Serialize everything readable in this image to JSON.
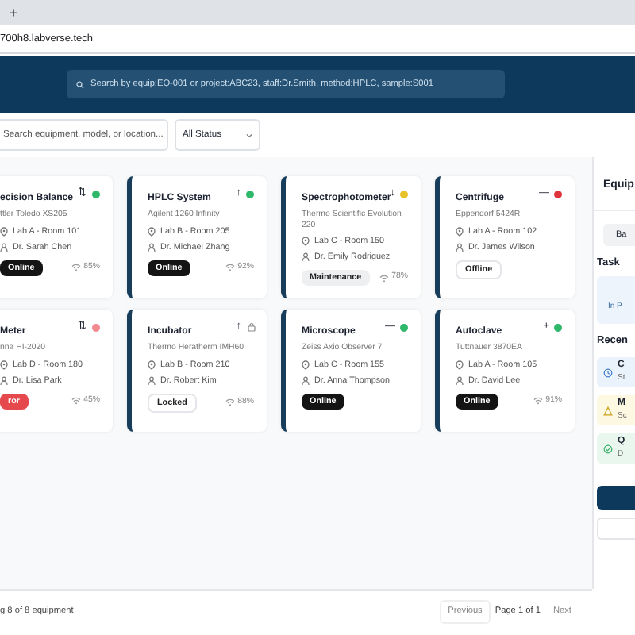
{
  "browser": {
    "new_tab": "+",
    "url": "700h8.labverse.tech"
  },
  "header": {
    "search_placeholder": "Search by equip:EQ-001 or project:ABC23, staff:Dr.Smith, method:HPLC, sample:S001"
  },
  "filters": {
    "search_placeholder": "Search equipment, model, or location...",
    "status_select": "All Status"
  },
  "cards": [
    {
      "title": "ecision Balance",
      "model": "ttler Toledo XS205",
      "location": "Lab A - Room 101",
      "staff": "Dr. Sarah Chen",
      "status": "Online",
      "kind": "online",
      "usage": "85%",
      "trend": "⇅",
      "locked": false,
      "color": "#2fb86a",
      "accent": false
    },
    {
      "title": "HPLC System",
      "model": "Agilent 1260 Infinity",
      "location": "Lab B - Room 205",
      "staff": "Dr. Michael Zhang",
      "status": "Online",
      "kind": "online",
      "usage": "92%",
      "trend": "↑",
      "locked": false,
      "color": "#2fb86a",
      "accent": true
    },
    {
      "title": "Spectrophotometer",
      "model": "Thermo Scientific Evolution 220",
      "location": "Lab C - Room 150",
      "staff": "Dr. Emily Rodriguez",
      "status": "Maintenance",
      "kind": "maintenance",
      "usage": "78%",
      "trend": "↓",
      "locked": false,
      "color": "#e8c22a",
      "accent": true
    },
    {
      "title": "Centrifuge",
      "model": "Eppendorf 5424R",
      "location": "Lab A - Room 102",
      "staff": "Dr. James Wilson",
      "status": "Offline",
      "kind": "offline",
      "trend": "—",
      "locked": false,
      "color": "#e0343c",
      "accent": true
    },
    {
      "title": "Meter",
      "model": "nna HI-2020",
      "location": "Lab D - Room 180",
      "staff": "Dr. Lisa Park",
      "status": "ror",
      "kind": "error",
      "usage": "45%",
      "trend": "⇅",
      "locked": false,
      "color": "#f08a8e",
      "accent": false
    },
    {
      "title": "Incubator",
      "model": "Thermo Heratherm IMH60",
      "location": "Lab B - Room 210",
      "staff": "Dr. Robert Kim",
      "status": "Locked",
      "kind": "locked",
      "usage": "88%",
      "trend": "↑",
      "locked": true,
      "accent": true
    },
    {
      "title": "Microscope",
      "model": "Zeiss Axio Observer 7",
      "location": "Lab C - Room 155",
      "staff": "Dr. Anna Thompson",
      "status": "Online",
      "kind": "online",
      "trend": "—",
      "locked": false,
      "color": "#2fb86a",
      "accent": true
    },
    {
      "title": "Autoclave",
      "model": "Tuttnauer 3870EA",
      "location": "Lab A - Room 105",
      "staff": "Dr. David Lee",
      "status": "Online",
      "kind": "online",
      "usage": "91%",
      "trend": "+",
      "locked": false,
      "color": "#2fb86a",
      "accent": true
    }
  ],
  "footer": {
    "summary": "g 8 of 8 equipment",
    "previous": "Previous",
    "page": "Page 1 of 1",
    "next": "Next"
  },
  "panel": {
    "title": "Equip",
    "tab": "Ba",
    "task_heading": "Task",
    "task_text": "In P",
    "recent_heading": "Recen",
    "recent": [
      {
        "kind": "info",
        "title": "C",
        "sub": "St"
      },
      {
        "kind": "warning",
        "title": "M",
        "sub": "Sc"
      },
      {
        "kind": "success",
        "title": "Q",
        "sub": "D"
      }
    ]
  }
}
